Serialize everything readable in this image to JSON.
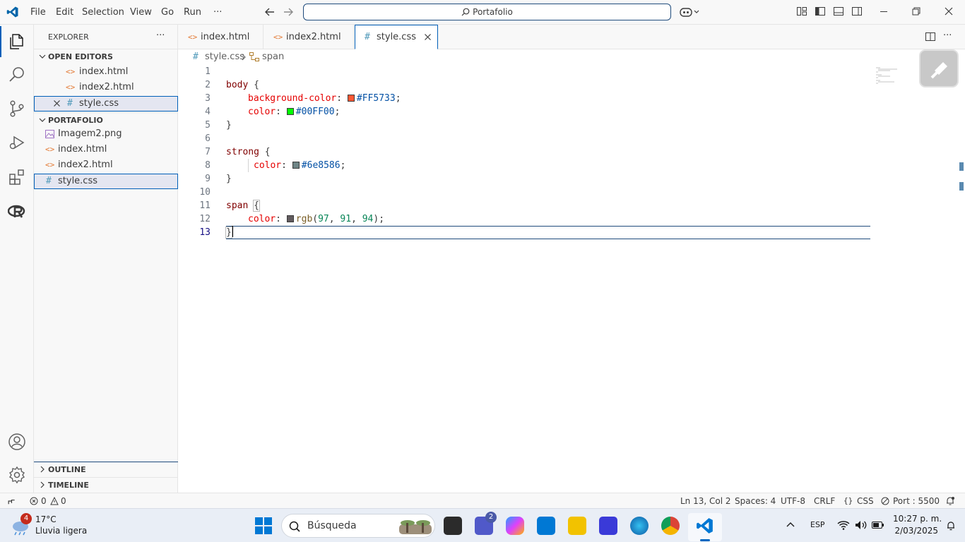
{
  "menu": [
    "File",
    "Edit",
    "Selection",
    "View",
    "Go",
    "Run",
    "···"
  ],
  "command_center": "Portafolio",
  "sidebar": {
    "title": "EXPLORER",
    "more": "···",
    "open_editors_title": "OPEN EDITORS",
    "open_editors": [
      "index.html",
      "index2.html",
      "style.css"
    ],
    "folder_title": "PORTAFOLIO",
    "files": [
      "Imagem2.png",
      "index.html",
      "index2.html",
      "style.css"
    ],
    "outline": "OUTLINE",
    "timeline": "TIMELINE"
  },
  "tabs": [
    {
      "label": "index.html"
    },
    {
      "label": "index2.html"
    },
    {
      "label": "style.css"
    }
  ],
  "breadcrumb": {
    "file": "style.css",
    "symbol": "span"
  },
  "editor": {
    "line_numbers": [
      "1",
      "2",
      "3",
      "4",
      "5",
      "6",
      "7",
      "8",
      "9",
      "10",
      "11",
      "12",
      "13"
    ],
    "l2_sel": "body",
    "l2_brace": " {",
    "l3_prop": "background-color",
    "l3_val": "#FF5733",
    "l4_prop": "color",
    "l4_val": "#00FF00",
    "l5": "}",
    "l7_sel": "strong",
    "l7_brace": " {",
    "l8_prop": "color",
    "l8_val": "#6e8586",
    "l9": "}",
    "l11_sel": "span",
    "l11_brace": "{",
    "l12_prop": "color",
    "l12_fn": "rgb",
    "l12_args": [
      "97",
      "91",
      "94"
    ],
    "l13": "}",
    "swatch_colors": {
      "l3": "#FF5733",
      "l4": "#00FF00",
      "l8": "#6e8586",
      "l12": "#615b5e"
    }
  },
  "status": {
    "errors": "0",
    "warnings": "0",
    "position": "Ln 13, Col 2",
    "spaces": "Spaces: 4",
    "encoding": "UTF-8",
    "eol": "CRLF",
    "language": "CSS",
    "port": "Port : 5500"
  },
  "taskbar": {
    "weather_temp": "17°C",
    "weather_desc": "Lluvia ligera",
    "weather_badge": "4",
    "search": "Búsqueda",
    "teams_badge": "2",
    "lang": "ESP",
    "time": "10:27 p. m.",
    "date": "2/03/2025"
  }
}
